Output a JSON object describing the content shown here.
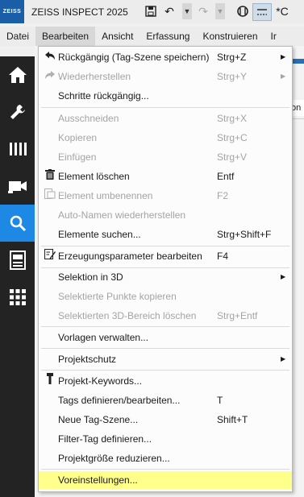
{
  "app": {
    "logo_text": "ZEISS",
    "title": "ZEISS INSPECT 2025"
  },
  "menubar": {
    "items": [
      "Datei",
      "Bearbeiten",
      "Ansicht",
      "Erfassung",
      "Konstruieren",
      "Ir"
    ],
    "active": "Bearbeiten"
  },
  "sidebar": {
    "icons": [
      "home-icon",
      "wrench-icon",
      "bars-icon",
      "camera-icon",
      "search-icon",
      "report-icon",
      "grid-icon"
    ],
    "active": "search-icon"
  },
  "background": {
    "tab_text": "on"
  },
  "menu": {
    "items": [
      {
        "label": "Rückgängig (Tag-Szene speichern)",
        "shortcut": "Strg+Z",
        "icon": "undo-icon",
        "submenu": true,
        "enabled": true
      },
      {
        "label": "Wiederherstellen",
        "shortcut": "Strg+Y",
        "icon": "redo-icon",
        "submenu": true,
        "enabled": false
      },
      {
        "label": "Schritte rückgängig...",
        "shortcut": "",
        "enabled": true
      },
      {
        "label": "Ausschneiden",
        "shortcut": "Strg+X",
        "enabled": false
      },
      {
        "label": "Kopieren",
        "shortcut": "Strg+C",
        "enabled": false
      },
      {
        "label": "Einfügen",
        "shortcut": "Strg+V",
        "enabled": false
      },
      {
        "label": "Element löschen",
        "shortcut": "Entf",
        "icon": "trash-icon",
        "enabled": true
      },
      {
        "label": "Element umbenennen",
        "shortcut": "F2",
        "icon": "rename-icon",
        "enabled": false
      },
      {
        "label": "Auto-Namen wiederherstellen",
        "shortcut": "",
        "enabled": false
      },
      {
        "label": "Elemente suchen...",
        "shortcut": "Strg+Shift+F",
        "enabled": true
      },
      {
        "label": "Erzeugungsparameter bearbeiten",
        "shortcut": "F4",
        "icon": "edit-params-icon",
        "enabled": true
      },
      {
        "label": "Selektion in 3D",
        "shortcut": "",
        "submenu": true,
        "enabled": true
      },
      {
        "label": "Selektierte Punkte kopieren",
        "shortcut": "",
        "enabled": false
      },
      {
        "label": "Selektierten 3D-Bereich löschen",
        "shortcut": "Strg+Entf",
        "enabled": false
      },
      {
        "label": "Vorlagen verwalten...",
        "shortcut": "",
        "enabled": true
      },
      {
        "label": "Projektschutz",
        "shortcut": "",
        "submenu": true,
        "enabled": true
      },
      {
        "label": "Projekt-Keywords...",
        "shortcut": "",
        "icon": "keywords-icon",
        "enabled": true
      },
      {
        "label": "Tags definieren/bearbeiten...",
        "shortcut": "T",
        "enabled": true
      },
      {
        "label": "Neue Tag-Szene...",
        "shortcut": "Shift+T",
        "enabled": true
      },
      {
        "label": "Filter-Tag definieren...",
        "shortcut": "",
        "enabled": true
      },
      {
        "label": "Projektgröße reduzieren...",
        "shortcut": "",
        "enabled": true
      },
      {
        "label": "Voreinstellungen...",
        "shortcut": "",
        "enabled": true,
        "highlighted": true
      }
    ]
  },
  "colors": {
    "highlight": "#ffff8c",
    "sidebar_active": "#1e88e5",
    "sidebar_bg": "#232323",
    "disabled_text": "#a4a4a4"
  }
}
